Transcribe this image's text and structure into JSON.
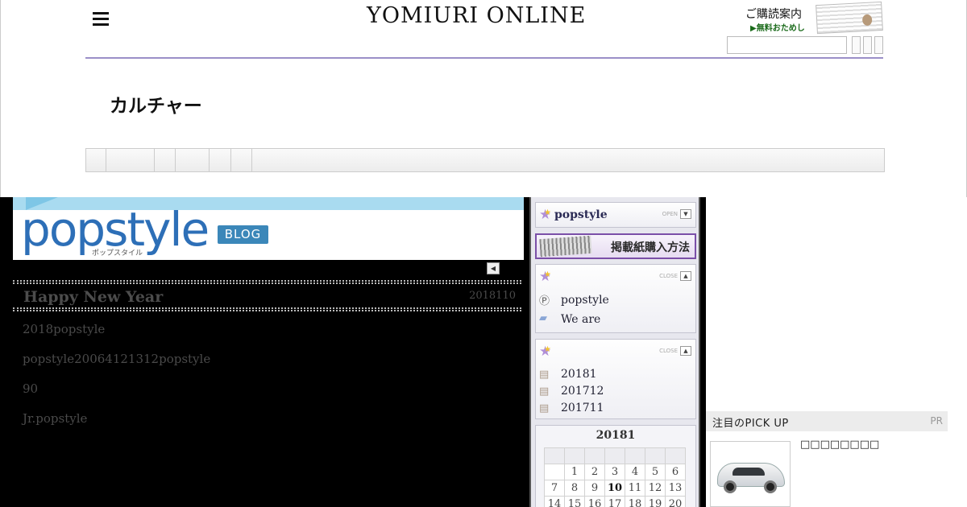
{
  "header": {
    "logo": "YOMIURI ONLINE",
    "subscribe_title": "ご購読案内",
    "subscribe_link": "▶無料おためし",
    "search_placeholder": ""
  },
  "section": {
    "title": "カルチャー"
  },
  "blog": {
    "banner_logo_pop": "pop",
    "banner_logo_style": "style",
    "banner_kana": "ポップスタイル",
    "banner_badge": "BLOG",
    "prev_button": "◀",
    "entry": {
      "title": "Happy New Year",
      "date": "2018110",
      "paragraphs": [
        "2018popstyle",
        "popstyle20064121312popstyle",
        "90",
        "Jr.popstyle"
      ]
    }
  },
  "sidebar": {
    "profile_box": {
      "title": "popstyle",
      "toggle": "OPEN"
    },
    "buy_banner": "掲載紙購入方法",
    "category_box": {
      "toggle": "CLOSE",
      "items": [
        "popstyle",
        "We are"
      ]
    },
    "archive_box": {
      "toggle": "CLOSE",
      "items": [
        "20181",
        "201712",
        "201711"
      ]
    },
    "calendar": {
      "title": "20181",
      "rows": [
        [
          "",
          "1",
          "2",
          "3",
          "4",
          "5",
          "6"
        ],
        [
          "7",
          "8",
          "9",
          "10",
          "11",
          "12",
          "13"
        ],
        [
          "14",
          "15",
          "16",
          "17",
          "18",
          "19",
          "20"
        ]
      ]
    }
  },
  "right": {
    "pr_title": "注目のPICK UP",
    "pr_tag": "PR",
    "pr_item_text": "□□□□□□□□"
  }
}
